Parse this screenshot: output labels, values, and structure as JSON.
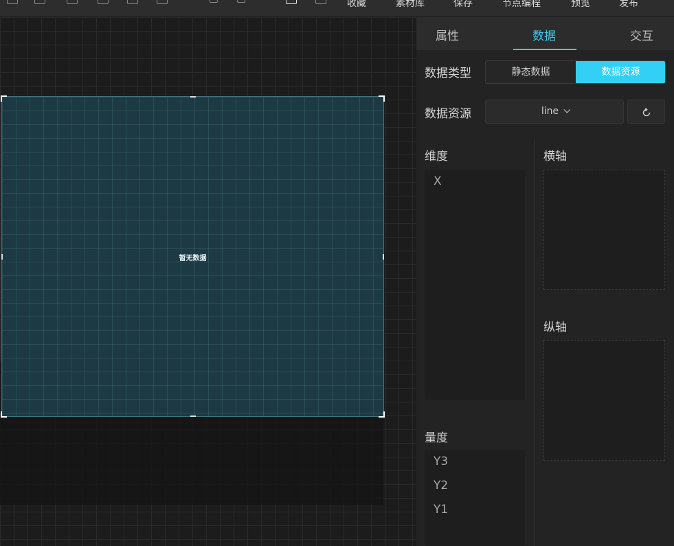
{
  "toolbar": {
    "items": [
      "收藏",
      "素材库",
      "保存",
      "节点编程",
      "预览",
      "发布"
    ]
  },
  "canvas": {
    "empty_text": "暂无数据"
  },
  "panel": {
    "tabs": [
      "属性",
      "数据",
      "交互"
    ],
    "active_tab": "数据",
    "data_type_label": "数据类型",
    "data_type_options": [
      "静态数据",
      "数据资源"
    ],
    "data_type_selected": "数据资源",
    "data_source_label": "数据资源",
    "data_source_value": "line",
    "dimension_label": "维度",
    "dimensions": [
      "X"
    ],
    "measure_label": "量度",
    "measures": [
      "Y3",
      "Y2",
      "Y1"
    ],
    "x_axis_label": "横轴",
    "y_axis_label": "纵轴"
  },
  "colors": {
    "accent": "#33d0f5",
    "tab_active": "#3fc9e8",
    "component_bg": "#1d3a44"
  },
  "icons": [
    "refresh-icon",
    "chevron-down-icon"
  ]
}
